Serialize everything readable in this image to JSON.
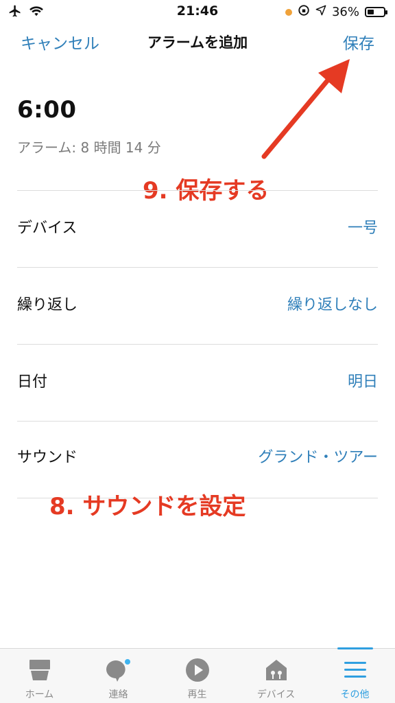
{
  "status_bar": {
    "time": "21:46",
    "battery": "36%"
  },
  "nav": {
    "cancel": "キャンセル",
    "title": "アラームを追加",
    "save": "保存"
  },
  "alarm": {
    "time": "6:00",
    "info": "アラーム:  8 時間 14 分"
  },
  "rows": [
    {
      "label": "デバイス",
      "value": "一号"
    },
    {
      "label": "繰り返し",
      "value": "繰り返しなし"
    },
    {
      "label": "日付",
      "value": "明日"
    },
    {
      "label": "サウンド",
      "value": "グランド・ツアー"
    }
  ],
  "annotations": {
    "step9": "9. 保存する",
    "step8": "8. サウンドを設定"
  },
  "tabs": [
    {
      "label": "ホーム",
      "icon": "home-icon"
    },
    {
      "label": "連絡",
      "icon": "chat-icon"
    },
    {
      "label": "再生",
      "icon": "play-icon"
    },
    {
      "label": "デバイス",
      "icon": "devices-icon"
    },
    {
      "label": "その他",
      "icon": "menu-icon",
      "active": true
    }
  ],
  "colors": {
    "accent": "#2f7fb9",
    "annotation": "#e53a23",
    "tab_active": "#2f9fe0"
  }
}
